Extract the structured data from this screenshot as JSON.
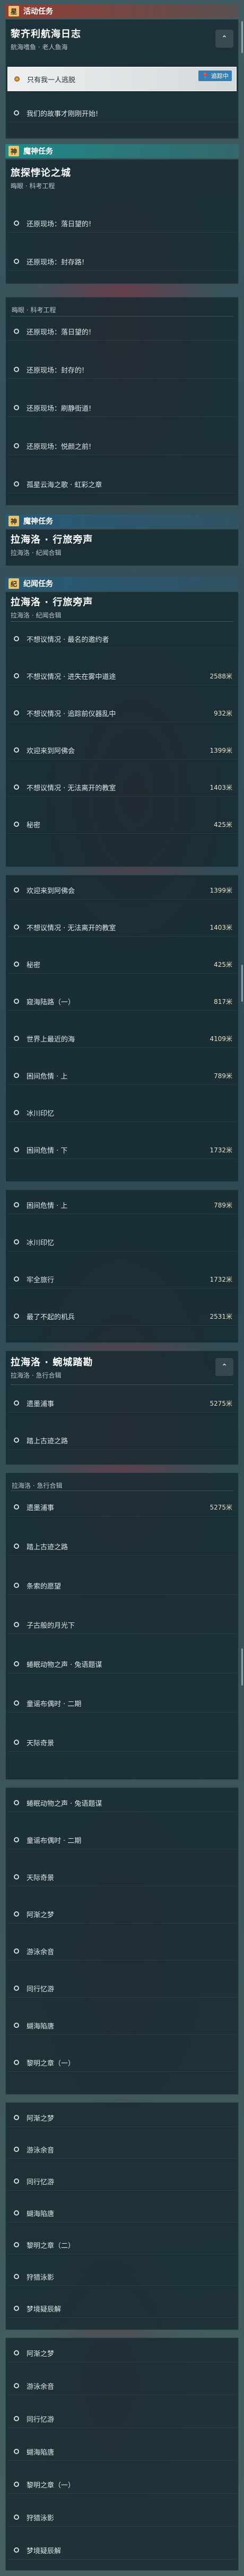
{
  "sections": {
    "activity": {
      "label": "活动任务",
      "icon": "星"
    },
    "archon": {
      "label": "魔神任务",
      "icon": "神"
    },
    "archon2": {
      "label": "魔神任务",
      "icon": "神"
    },
    "story": {
      "label": "纪闻任务",
      "icon": "纪"
    }
  },
  "quest1": {
    "title": "黎齐利航海日志",
    "subtitle": "航海嗜鱼 · 老人鱼海",
    "tag": "追踪中",
    "steps": [
      "只有我一人逃脱",
      "我们的故事才刚刚开始!"
    ]
  },
  "quest2": {
    "title": "旅探悖论之城",
    "subtitle": "晦眼 · 科考工程",
    "steps": [
      "还原现场：落日望的!",
      "还原现场：封存路!"
    ]
  },
  "quest2b": {
    "subtitle": "晦眼 · 科考工程",
    "steps": [
      "还原现场：落日望的!",
      "还原现场：封存的!",
      "还原现场：刷静街道!",
      "还原现场：悦颜之前!",
      "孤星云海之歌 · 虹彩之章"
    ]
  },
  "quest3": {
    "title": "拉海洛 · 行旅旁声",
    "subtitle": "拉海洛 · 纪闻合辑"
  },
  "quest4": {
    "title": "拉海洛 · 行旅旁声",
    "subtitle": "拉海洛 · 纪闻合辑",
    "steps": [
      {
        "label": "不想议情况 · 最名的邀约者",
        "dist": ""
      },
      {
        "label": "不想议情况 · 进失在雾中道途",
        "dist": "2588米"
      },
      {
        "label": "不想议情况 · 追踪前仪器乱中",
        "dist": "932米"
      },
      {
        "label": "欢迎来到阿佛会",
        "dist": "1399米"
      },
      {
        "label": "不想议情况 · 无法离开的教室",
        "dist": "1403米"
      },
      {
        "label": "秘密",
        "dist": "425米"
      }
    ]
  },
  "quest4b": {
    "steps": [
      {
        "label": "欢迎来到阿佛会",
        "dist": "1399米"
      },
      {
        "label": "不想议情况 · 无法离开的教室",
        "dist": "1403米"
      },
      {
        "label": "秘密",
        "dist": "425米"
      },
      {
        "label": "窥海陆路（一）",
        "dist": "817米"
      },
      {
        "label": "世界上最近的海",
        "dist": "4109米"
      },
      {
        "label": "困间危情 · 上",
        "dist": "789米"
      },
      {
        "label": "冰川印忆",
        "dist": ""
      },
      {
        "label": "困间危情 · 下",
        "dist": "1732米"
      }
    ]
  },
  "quest4c": {
    "steps": [
      {
        "label": "困间危情 · 上",
        "dist": "789米"
      },
      {
        "label": "冰川印忆",
        "dist": ""
      },
      {
        "label": "牢全旅行",
        "dist": "1732米"
      },
      {
        "label": "最了不起的机兵",
        "dist": "2531米"
      }
    ]
  },
  "quest5": {
    "title": "拉海洛 · 蜿城踏勘",
    "subtitle": "拉海洛 · 急行合辑",
    "steps": [
      {
        "label": "遗墨浦事",
        "dist": "5275米"
      },
      {
        "label": "踏上古迹之路",
        "dist": ""
      }
    ]
  },
  "quest5b": {
    "subtitle": "拉海洛 · 急行合辑",
    "steps": [
      {
        "label": "遗墨浦事",
        "dist": "5275米"
      },
      {
        "label": "踏上古迹之路",
        "dist": ""
      },
      {
        "label": "条索的愿望",
        "dist": ""
      },
      {
        "label": "子古般的月光下",
        "dist": ""
      },
      {
        "label": "蜷眠动物之声 · 兔语题谋",
        "dist": ""
      },
      {
        "label": "童谣布偶时 · 二期",
        "dist": ""
      },
      {
        "label": "天际奇景",
        "dist": ""
      }
    ]
  },
  "quest5c": {
    "steps": [
      {
        "label": "蜷眠动物之声 · 兔语题谋",
        "dist": ""
      },
      {
        "label": "童谣布偶时 · 二期",
        "dist": ""
      },
      {
        "label": "天际奇景",
        "dist": ""
      },
      {
        "label": "阿渐之梦",
        "dist": ""
      },
      {
        "label": "游泳余音",
        "dist": ""
      },
      {
        "label": "同行忆游",
        "dist": ""
      },
      {
        "label": "蝴海陷唐",
        "dist": ""
      },
      {
        "label": "黎明之章（一）",
        "dist": ""
      }
    ]
  },
  "quest5d": {
    "steps": [
      {
        "label": "阿渐之梦",
        "dist": ""
      },
      {
        "label": "游泳余音",
        "dist": ""
      },
      {
        "label": "同行忆游",
        "dist": ""
      },
      {
        "label": "蝴海陷唐",
        "dist": ""
      },
      {
        "label": "黎明之章（二）",
        "dist": ""
      },
      {
        "label": "狩猎泳影",
        "dist": ""
      },
      {
        "label": "梦境疑辰解",
        "dist": ""
      }
    ]
  },
  "quest5e": {
    "steps": [
      {
        "label": "阿渐之梦",
        "dist": ""
      },
      {
        "label": "游泳余音",
        "dist": ""
      },
      {
        "label": "同行忆游",
        "dist": ""
      },
      {
        "label": "蝴海陷唐",
        "dist": ""
      },
      {
        "label": "黎明之章（一）",
        "dist": ""
      },
      {
        "label": "狩猎泳影",
        "dist": ""
      },
      {
        "label": "梦境疑辰解",
        "dist": ""
      }
    ]
  }
}
